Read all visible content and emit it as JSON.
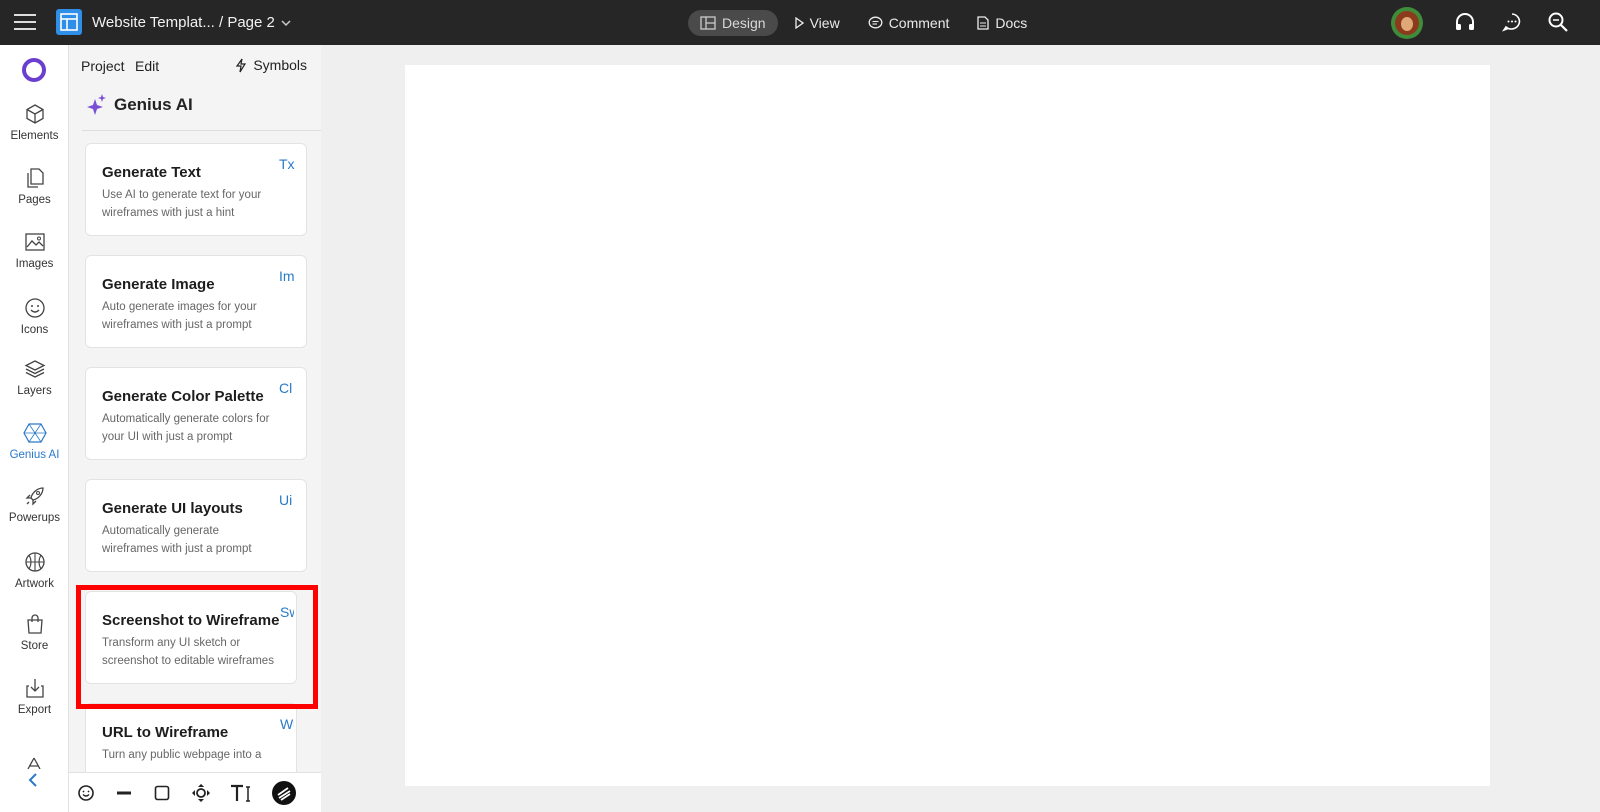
{
  "topbar": {
    "doc_title": "Website Templat... / Page 2",
    "tabs": [
      {
        "label": "Design",
        "icon": "layout-icon",
        "active": true
      },
      {
        "label": "View",
        "icon": "play-icon",
        "active": false
      },
      {
        "label": "Comment",
        "icon": "comment-icon",
        "active": false
      },
      {
        "label": "Docs",
        "icon": "doc-icon",
        "active": false
      }
    ],
    "right_icons": [
      "avatar",
      "headphones-icon",
      "chat-icon",
      "search-icon"
    ]
  },
  "rail": {
    "items": [
      {
        "label": "Elements",
        "icon": "cube-icon"
      },
      {
        "label": "Pages",
        "icon": "pages-icon"
      },
      {
        "label": "Images",
        "icon": "image-icon"
      },
      {
        "label": "Icons",
        "icon": "smiley-icon"
      },
      {
        "label": "Layers",
        "icon": "layers-icon"
      },
      {
        "label": "Genius AI",
        "icon": "genius-icon",
        "active": true
      },
      {
        "label": "Powerups",
        "icon": "rocket-icon"
      },
      {
        "label": "Artwork",
        "icon": "basketball-icon"
      },
      {
        "label": "Store",
        "icon": "bag-icon"
      },
      {
        "label": "Export",
        "icon": "export-icon"
      }
    ]
  },
  "panel": {
    "menu": {
      "project": "Project",
      "edit": "Edit",
      "symbols": "Symbols"
    },
    "header": "Genius AI",
    "cards": [
      {
        "title": "Generate Text",
        "desc": "Use AI to generate text for your wireframes with just a hint",
        "abbr": "Tx"
      },
      {
        "title": "Generate Image",
        "desc": "Auto generate images for your wireframes with just a prompt",
        "abbr": "Im"
      },
      {
        "title": "Generate Color Palette",
        "desc": "Automatically generate colors for your UI with just a prompt",
        "abbr": "Cl"
      },
      {
        "title": "Generate UI layouts",
        "desc": "Automatically generate wireframes with just a prompt",
        "abbr": "Ui"
      },
      {
        "title": "Screenshot to Wireframe",
        "desc": "Transform any UI sketch or screenshot to editable wireframes",
        "abbr": "Sw"
      },
      {
        "title": "URL to Wireframe",
        "desc": "Turn any public webpage into a",
        "abbr": "Wu"
      }
    ]
  },
  "colors": {
    "accent": "#2a79c8",
    "highlight": "#ff0000",
    "topbar": "#262626"
  }
}
